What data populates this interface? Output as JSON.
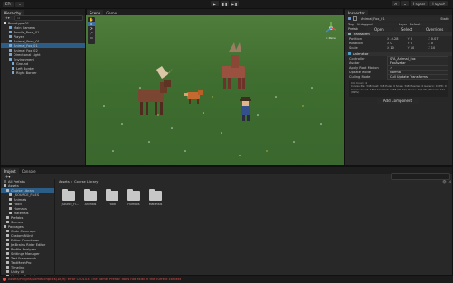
{
  "toolbar": {
    "account_label": "ED",
    "tools": [
      "▢",
      "⇵",
      "⚙"
    ],
    "play": "▶",
    "pause": "❚❚",
    "step": "▶❚",
    "layers_label": "Layers",
    "layout_label": "Layout"
  },
  "hierarchy": {
    "tab": "Hierarchy",
    "search_placeholder": "All",
    "items": [
      {
        "label": "Prototype 01",
        "indent": 0,
        "selected": false
      },
      {
        "label": "Main Camera",
        "indent": 2,
        "selected": false
      },
      {
        "label": "Poodle_Pose_01",
        "indent": 2,
        "selected": false
      },
      {
        "label": "Player",
        "indent": 2,
        "selected": false
      },
      {
        "label": "Animal_Pose_01",
        "indent": 2,
        "selected": false
      },
      {
        "label": "Animal_Fox_01",
        "indent": 2,
        "selected": true
      },
      {
        "label": "Animal_Fox_02",
        "indent": 2,
        "selected": false
      },
      {
        "label": "Directional Light",
        "indent": 2,
        "selected": false
      },
      {
        "label": "Environment",
        "indent": 2,
        "selected": false
      },
      {
        "label": "Ground",
        "indent": 3,
        "selected": false
      },
      {
        "label": "Left Border",
        "indent": 3,
        "selected": false
      },
      {
        "label": "Right Border",
        "indent": 3,
        "selected": false
      }
    ]
  },
  "scene": {
    "tabs": [
      "Scene",
      "Game"
    ],
    "view_2d": "2D",
    "persp_label": "< Persp"
  },
  "inspector": {
    "tab": "Inspector",
    "object_name": "Animal_Fox_01",
    "static_label": "Static",
    "tag_label": "Tag",
    "tag_value": "Untagged",
    "layer_label": "Layer",
    "layer_value": "Default",
    "prefab_label": "Prefab",
    "prefab_buttons": [
      "Open",
      "Select",
      "Overrides"
    ],
    "transform": {
      "title": "Transform",
      "rows": [
        {
          "label": "Position",
          "x": "-0.28",
          "y": "0",
          "z": "0.07"
        },
        {
          "label": "Rotation",
          "x": "0",
          "y": "0",
          "z": "0"
        },
        {
          "label": "Scale",
          "x": "10",
          "y": "10",
          "z": "10"
        }
      ]
    },
    "animator": {
      "title": "Animator",
      "rows": [
        {
          "label": "Controller",
          "value": "SFA_Animal_Fox"
        },
        {
          "label": "Avatar",
          "value": "FoxAvatar"
        },
        {
          "label": "Apply Root Motion",
          "value": "✓"
        },
        {
          "label": "Update Mode",
          "value": "Normal"
        },
        {
          "label": "Culling Mode",
          "value": "Cull Update Transforms"
        }
      ],
      "clip_info": "Clip Count: 4\nCurves Pos: 348 Quat: 348 Euler: 0 Scale: 348 Muscles: 0 Generic: 0 PPtr: 0\nCurves Count: 1392 Constant: 1268 (91.1%) Dense: 0 (0.0%) Stream: 124 (8.9%)"
    },
    "add_component": "Add Component"
  },
  "project": {
    "tabs": [
      "Project",
      "Console"
    ],
    "search_placeholder": "",
    "favorites_label": "All Prefabs",
    "tree": [
      {
        "label": "Assets",
        "indent": 0,
        "selected": false
      },
      {
        "label": "Course Library",
        "indent": 1,
        "selected": true
      },
      {
        "label": "_SOURCE_FILES",
        "indent": 2,
        "selected": false
      },
      {
        "label": "Animals",
        "indent": 2,
        "selected": false
      },
      {
        "label": "Food",
        "indent": 2,
        "selected": false
      },
      {
        "label": "Humans",
        "indent": 2,
        "selected": false
      },
      {
        "label": "Materials",
        "indent": 2,
        "selected": false
      },
      {
        "label": "Prefabs",
        "indent": 1,
        "selected": false
      },
      {
        "label": "Scenes",
        "indent": 1,
        "selected": false
      },
      {
        "label": "Packages",
        "indent": 0,
        "selected": false
      },
      {
        "label": "Code Coverage",
        "indent": 1,
        "selected": false
      },
      {
        "label": "Custom NUnit",
        "indent": 1,
        "selected": false
      },
      {
        "label": "Editor Coroutines",
        "indent": 1,
        "selected": false
      },
      {
        "label": "JetBrains Rider Editor",
        "indent": 1,
        "selected": false
      },
      {
        "label": "Profile Analyzer",
        "indent": 1,
        "selected": false
      },
      {
        "label": "Settings Manager",
        "indent": 1,
        "selected": false
      },
      {
        "label": "Test Framework",
        "indent": 1,
        "selected": false
      },
      {
        "label": "TextMeshPro",
        "indent": 1,
        "selected": false
      },
      {
        "label": "Timeline",
        "indent": 1,
        "selected": false
      },
      {
        "label": "Unity UI",
        "indent": 1,
        "selected": false
      },
      {
        "label": "Version Control",
        "indent": 1,
        "selected": false
      }
    ],
    "breadcrumb": [
      "Assets",
      "Course Library"
    ],
    "folders": [
      "_Source_Fi...",
      "Animals",
      "Food",
      "Humans",
      "Materials"
    ],
    "item_count": "14"
  },
  "status_bar": {
    "message": "Assets/Plugins/SomeScript.cs(18,9): error CS0103: The name 'Prefab' does not exist in the current context"
  },
  "colors": {
    "accent_selection": "#2c5d87",
    "grass": "#4f7d3b",
    "error_text": "#e05050"
  }
}
